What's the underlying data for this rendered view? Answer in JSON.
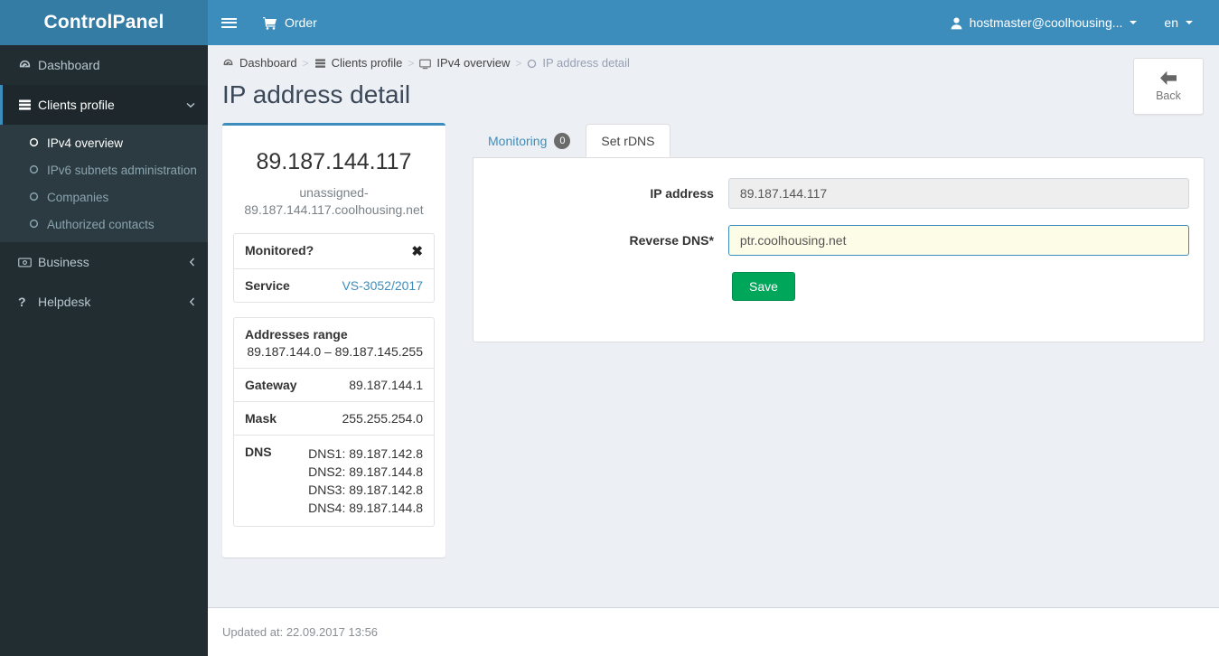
{
  "brand": {
    "title": "ControlPanel"
  },
  "colors": {
    "header_blue": "#3c8dbc",
    "logo_blue": "#357ca5",
    "sidebar_dark": "#222d32",
    "submenu_bg": "#2c3b41",
    "content_bg": "#ecf0f5",
    "link_blue": "#3c8dbc",
    "save_green": "#00a65a",
    "highlight_yellow": "#fdfde7",
    "badge_gray": "#6b6b6b"
  },
  "header": {
    "hamburger_icon": "hamburger-icon",
    "order_label": "Order",
    "order_icon": "shopping-cart-icon",
    "user_label": "hostmaster@coolhousing...",
    "user_icon": "user-icon",
    "lang_label": "en"
  },
  "sidebar": {
    "items": [
      {
        "label": "Dashboard",
        "icon": "dashboard-icon",
        "active": false,
        "arrow": ""
      },
      {
        "label": "Clients profile",
        "icon": "server-icon",
        "active": true,
        "arrow": "chevron-down-icon"
      },
      {
        "label": "Business",
        "icon": "money-icon",
        "active": false,
        "arrow": "chevron-left-icon"
      },
      {
        "label": "Helpdesk",
        "icon": "question-icon",
        "active": false,
        "arrow": "chevron-left-icon"
      }
    ],
    "submenu": [
      {
        "label": "IPv4 overview",
        "icon": "circle-icon",
        "active": true
      },
      {
        "label": "IPv6 subnets administration",
        "icon": "circle-icon",
        "active": false
      },
      {
        "label": "Companies",
        "icon": "circle-icon",
        "active": false
      },
      {
        "label": "Authorized contacts",
        "icon": "circle-icon",
        "active": false
      }
    ]
  },
  "breadcrumb": {
    "items": [
      {
        "label": "Dashboard",
        "icon": "dashboard-icon"
      },
      {
        "label": "Clients profile",
        "icon": "server-icon"
      },
      {
        "label": "IPv4 overview",
        "icon": "monitor-icon"
      },
      {
        "label": "IP address detail",
        "icon": "circle-icon"
      }
    ],
    "separator": ">"
  },
  "page": {
    "title": "IP address detail"
  },
  "back_button": {
    "label": "Back",
    "icon": "arrow-left-icon"
  },
  "info_card": {
    "ip": "89.187.144.117",
    "hostname_line1": "unassigned-",
    "hostname_line2": "89.187.144.117.coolhousing.net",
    "status_rows": [
      {
        "key": "Monitored?",
        "value": "✖",
        "is_icon": true
      },
      {
        "key": "Service",
        "value": "VS-3052/2017",
        "is_link": true
      }
    ],
    "network_rows": [
      {
        "key": "Addresses range",
        "value": "89.187.144.0 – 89.187.145.255",
        "stacked": true
      },
      {
        "key": "Gateway",
        "value": "89.187.144.1"
      },
      {
        "key": "Mask",
        "value": "255.255.254.0"
      }
    ],
    "dns": {
      "key": "DNS",
      "lines": [
        "DNS1: 89.187.142.8",
        "DNS2: 89.187.144.8",
        "DNS3: 89.187.142.8",
        "DNS4: 89.187.144.8"
      ]
    }
  },
  "tabs": [
    {
      "label": "Monitoring",
      "badge": "0",
      "active": false
    },
    {
      "label": "Set rDNS",
      "badge": null,
      "active": true
    }
  ],
  "form": {
    "ip_label": "IP address",
    "ip_value": "89.187.144.117",
    "rdns_label": "Reverse DNS*",
    "rdns_value": "ptr.coolhousing.net",
    "rdns_placeholder": "ptr.coolhousing.net",
    "save_label": "Save"
  },
  "footer": {
    "updated_text": "Updated at: 22.09.2017 13:56"
  }
}
